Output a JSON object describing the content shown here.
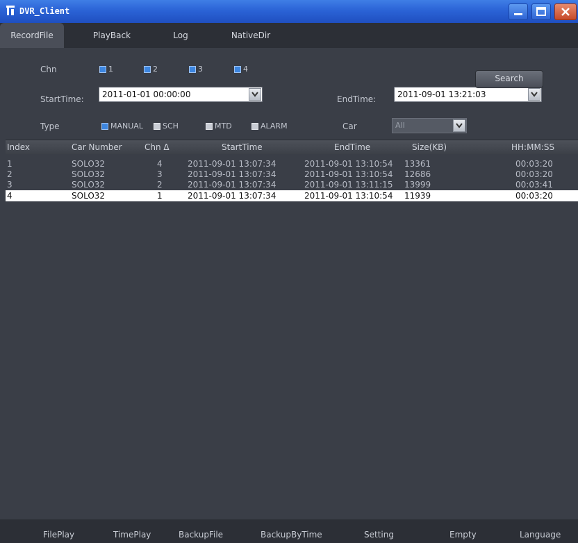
{
  "window": {
    "title": "DVR_Client"
  },
  "menu": {
    "tabs": [
      {
        "label": "RecordFile"
      },
      {
        "label": "PlayBack"
      },
      {
        "label": "Log"
      },
      {
        "label": "NativeDir"
      }
    ]
  },
  "filter": {
    "chn_label": "Chn",
    "channels": [
      "1",
      "2",
      "3",
      "4"
    ],
    "start_label": "StartTime:",
    "start_value": "2011-01-01 00:00:00",
    "end_label": "EndTime:",
    "end_value": "2011-09-01 13:21:03",
    "type_label": "Type",
    "types": [
      "MANUAL",
      "SCH",
      "MTD",
      "ALARM"
    ],
    "car_label": "Car",
    "car_value": "All",
    "search_label": "Search"
  },
  "table": {
    "headers": [
      "Index",
      "Car Number",
      "Chn",
      "StartTime",
      "EndTime",
      "Size(KB)",
      "HH:MM:SS"
    ],
    "sort_indicator": "Δ",
    "rows": [
      {
        "index": "1",
        "car": "SOLO32",
        "chn": "4",
        "start": "2011-09-01 13:07:34",
        "end": "2011-09-01 13:10:54",
        "size": "13361",
        "dur": "00:03:20"
      },
      {
        "index": "2",
        "car": "SOLO32",
        "chn": "3",
        "start": "2011-09-01 13:07:34",
        "end": "2011-09-01 13:10:54",
        "size": "12686",
        "dur": "00:03:20"
      },
      {
        "index": "3",
        "car": "SOLO32",
        "chn": "2",
        "start": "2011-09-01 13:07:34",
        "end": "2011-09-01 13:11:15",
        "size": "13999",
        "dur": "00:03:41"
      },
      {
        "index": "4",
        "car": "SOLO32",
        "chn": "1",
        "start": "2011-09-01 13:07:34",
        "end": "2011-09-01 13:10:54",
        "size": "11939",
        "dur": "00:03:20"
      }
    ]
  },
  "toolbar": {
    "buttons": [
      "FilePlay",
      "TimePlay",
      "BackupFile",
      "BackupByTime",
      "Setting",
      "Empty",
      "Language"
    ]
  }
}
